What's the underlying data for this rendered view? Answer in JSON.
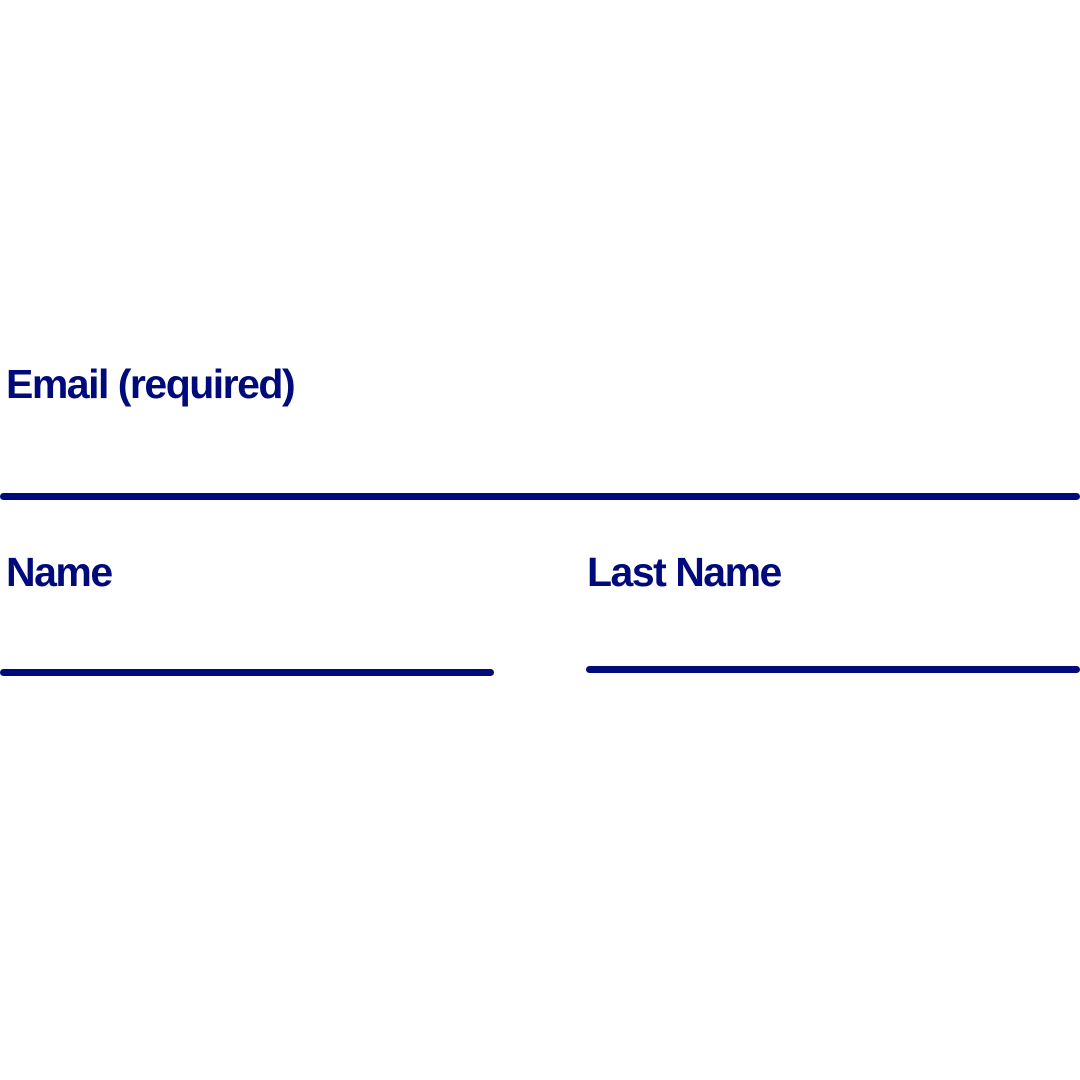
{
  "form": {
    "email": {
      "label": "Email (required)",
      "value": "",
      "placeholder": ""
    },
    "name": {
      "label": "Name",
      "value": "",
      "placeholder": ""
    },
    "last_name": {
      "label": "Last Name",
      "value": "",
      "placeholder": ""
    }
  },
  "colors": {
    "accent": "#000a7a",
    "background": "#ffffff"
  }
}
